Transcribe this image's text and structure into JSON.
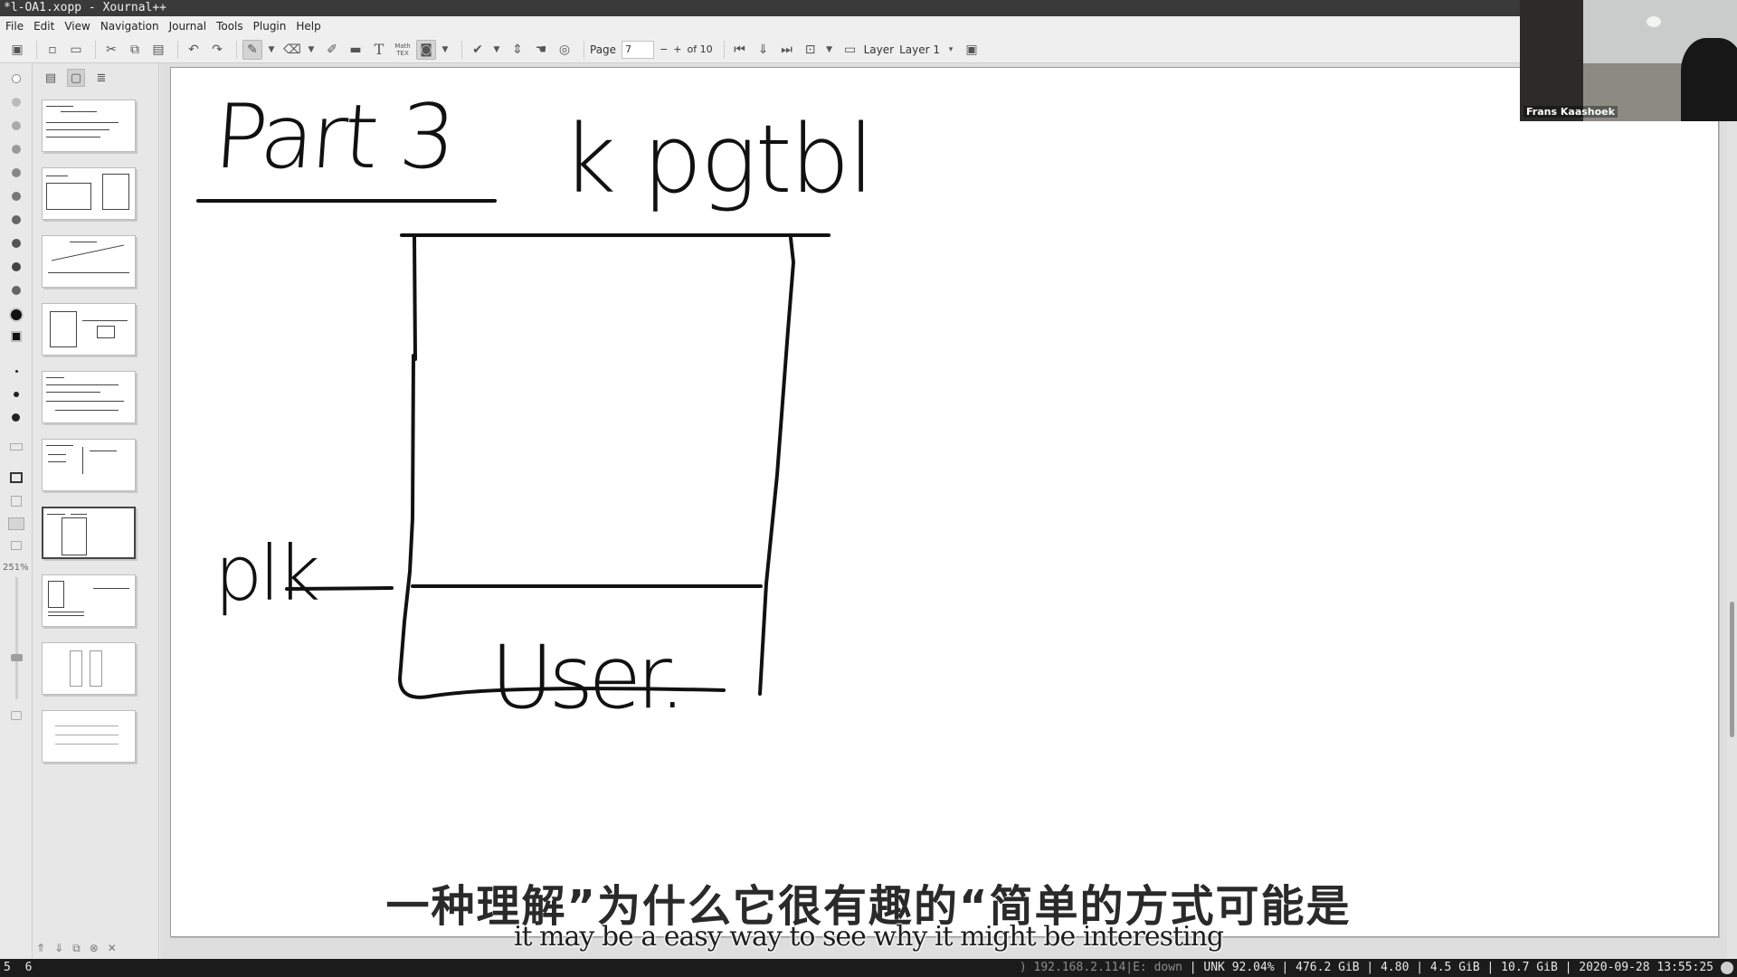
{
  "window": {
    "title": "*l-OA1.xopp - Xournal++"
  },
  "menubar": [
    "File",
    "Edit",
    "View",
    "Navigation",
    "Journal",
    "Tools",
    "Plugin",
    "Help"
  ],
  "toolbar": {
    "page_label": "Page",
    "page_value": "7",
    "page_minus": "−",
    "page_plus": "+",
    "page_of": "of 10",
    "layer_label": "Layer",
    "layer_value": "Layer 1",
    "mathtex": "Math TEX"
  },
  "zoom": {
    "label": "251%"
  },
  "webcam": {
    "name": "Frans Kaashoek"
  },
  "sidebar": {
    "page_count": 10,
    "selected_page": 7
  },
  "drawing": {
    "heading": "Part 3",
    "kpagetable": "k pgtbl",
    "pointer_label": "plk",
    "user_label": "User."
  },
  "subtitles": {
    "zh": "一种理解”为什么它很有趣的“简单的方式可能是",
    "en": "it may be a easy way to see why it might be interesting"
  },
  "statusbar": {
    "workspaces": [
      "5",
      "6"
    ],
    "ip": ") 192.168.2.114",
    "eth": "E: down",
    "unk": "UNK 92.04%",
    "disk": "476.2 GiB",
    "load": "4.80",
    "mem": "4.5 GiB",
    "swap": "10.7 GiB",
    "datetime": "2020-09-28 13:55:25"
  },
  "colors": {
    "accent": "#3a3a3a",
    "ink": "#111111",
    "page": "#ffffff"
  }
}
